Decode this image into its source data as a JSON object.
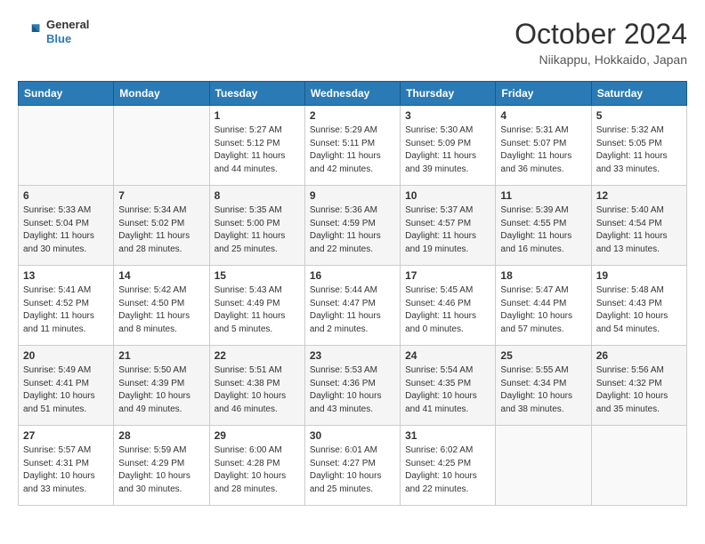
{
  "header": {
    "logo_general": "General",
    "logo_blue": "Blue",
    "month_title": "October 2024",
    "location": "Niikappu, Hokkaido, Japan"
  },
  "days_of_week": [
    "Sunday",
    "Monday",
    "Tuesday",
    "Wednesday",
    "Thursday",
    "Friday",
    "Saturday"
  ],
  "weeks": [
    [
      {
        "day": "",
        "info": ""
      },
      {
        "day": "",
        "info": ""
      },
      {
        "day": "1",
        "info": "Sunrise: 5:27 AM\nSunset: 5:12 PM\nDaylight: 11 hours and 44 minutes."
      },
      {
        "day": "2",
        "info": "Sunrise: 5:29 AM\nSunset: 5:11 PM\nDaylight: 11 hours and 42 minutes."
      },
      {
        "day": "3",
        "info": "Sunrise: 5:30 AM\nSunset: 5:09 PM\nDaylight: 11 hours and 39 minutes."
      },
      {
        "day": "4",
        "info": "Sunrise: 5:31 AM\nSunset: 5:07 PM\nDaylight: 11 hours and 36 minutes."
      },
      {
        "day": "5",
        "info": "Sunrise: 5:32 AM\nSunset: 5:05 PM\nDaylight: 11 hours and 33 minutes."
      }
    ],
    [
      {
        "day": "6",
        "info": "Sunrise: 5:33 AM\nSunset: 5:04 PM\nDaylight: 11 hours and 30 minutes."
      },
      {
        "day": "7",
        "info": "Sunrise: 5:34 AM\nSunset: 5:02 PM\nDaylight: 11 hours and 28 minutes."
      },
      {
        "day": "8",
        "info": "Sunrise: 5:35 AM\nSunset: 5:00 PM\nDaylight: 11 hours and 25 minutes."
      },
      {
        "day": "9",
        "info": "Sunrise: 5:36 AM\nSunset: 4:59 PM\nDaylight: 11 hours and 22 minutes."
      },
      {
        "day": "10",
        "info": "Sunrise: 5:37 AM\nSunset: 4:57 PM\nDaylight: 11 hours and 19 minutes."
      },
      {
        "day": "11",
        "info": "Sunrise: 5:39 AM\nSunset: 4:55 PM\nDaylight: 11 hours and 16 minutes."
      },
      {
        "day": "12",
        "info": "Sunrise: 5:40 AM\nSunset: 4:54 PM\nDaylight: 11 hours and 13 minutes."
      }
    ],
    [
      {
        "day": "13",
        "info": "Sunrise: 5:41 AM\nSunset: 4:52 PM\nDaylight: 11 hours and 11 minutes."
      },
      {
        "day": "14",
        "info": "Sunrise: 5:42 AM\nSunset: 4:50 PM\nDaylight: 11 hours and 8 minutes."
      },
      {
        "day": "15",
        "info": "Sunrise: 5:43 AM\nSunset: 4:49 PM\nDaylight: 11 hours and 5 minutes."
      },
      {
        "day": "16",
        "info": "Sunrise: 5:44 AM\nSunset: 4:47 PM\nDaylight: 11 hours and 2 minutes."
      },
      {
        "day": "17",
        "info": "Sunrise: 5:45 AM\nSunset: 4:46 PM\nDaylight: 11 hours and 0 minutes."
      },
      {
        "day": "18",
        "info": "Sunrise: 5:47 AM\nSunset: 4:44 PM\nDaylight: 10 hours and 57 minutes."
      },
      {
        "day": "19",
        "info": "Sunrise: 5:48 AM\nSunset: 4:43 PM\nDaylight: 10 hours and 54 minutes."
      }
    ],
    [
      {
        "day": "20",
        "info": "Sunrise: 5:49 AM\nSunset: 4:41 PM\nDaylight: 10 hours and 51 minutes."
      },
      {
        "day": "21",
        "info": "Sunrise: 5:50 AM\nSunset: 4:39 PM\nDaylight: 10 hours and 49 minutes."
      },
      {
        "day": "22",
        "info": "Sunrise: 5:51 AM\nSunset: 4:38 PM\nDaylight: 10 hours and 46 minutes."
      },
      {
        "day": "23",
        "info": "Sunrise: 5:53 AM\nSunset: 4:36 PM\nDaylight: 10 hours and 43 minutes."
      },
      {
        "day": "24",
        "info": "Sunrise: 5:54 AM\nSunset: 4:35 PM\nDaylight: 10 hours and 41 minutes."
      },
      {
        "day": "25",
        "info": "Sunrise: 5:55 AM\nSunset: 4:34 PM\nDaylight: 10 hours and 38 minutes."
      },
      {
        "day": "26",
        "info": "Sunrise: 5:56 AM\nSunset: 4:32 PM\nDaylight: 10 hours and 35 minutes."
      }
    ],
    [
      {
        "day": "27",
        "info": "Sunrise: 5:57 AM\nSunset: 4:31 PM\nDaylight: 10 hours and 33 minutes."
      },
      {
        "day": "28",
        "info": "Sunrise: 5:59 AM\nSunset: 4:29 PM\nDaylight: 10 hours and 30 minutes."
      },
      {
        "day": "29",
        "info": "Sunrise: 6:00 AM\nSunset: 4:28 PM\nDaylight: 10 hours and 28 minutes."
      },
      {
        "day": "30",
        "info": "Sunrise: 6:01 AM\nSunset: 4:27 PM\nDaylight: 10 hours and 25 minutes."
      },
      {
        "day": "31",
        "info": "Sunrise: 6:02 AM\nSunset: 4:25 PM\nDaylight: 10 hours and 22 minutes."
      },
      {
        "day": "",
        "info": ""
      },
      {
        "day": "",
        "info": ""
      }
    ]
  ]
}
